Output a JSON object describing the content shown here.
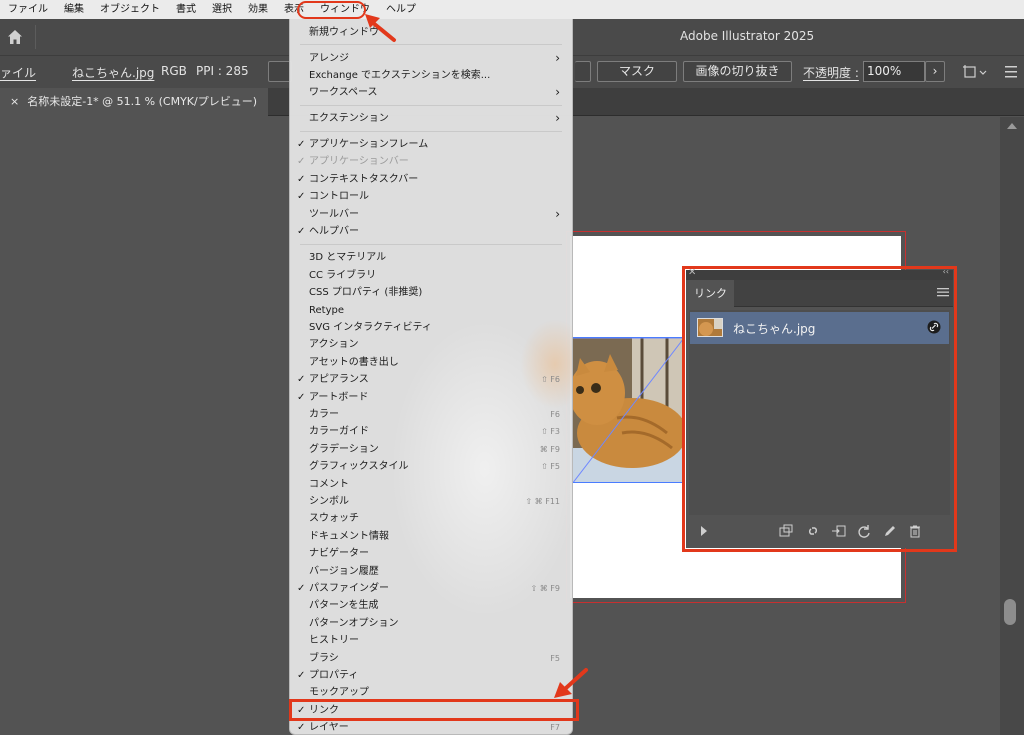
{
  "menubar": {
    "items": [
      "ファイル",
      "編集",
      "オブジェクト",
      "書式",
      "選択",
      "効果",
      "表示",
      "ウィンドウ",
      "ヘルプ"
    ],
    "active_index": 7
  },
  "app": {
    "title": "Adobe Illustrator 2025"
  },
  "control_bar": {
    "file_label_cut": "ァイル",
    "filename": "ねこちゃん.jpg",
    "color_mode": "RGB",
    "ppi": "PPI : 285",
    "mask_button": "マスク",
    "crop_button": "画像の切り抜き",
    "opacity_label": "不透明度 :",
    "opacity_value": "100%"
  },
  "document_tab": {
    "close": "×",
    "title": "名称未設定-1* @ 51.1 % (CMYK/プレビュー)"
  },
  "links_panel": {
    "tab_label": "リンク",
    "items": [
      {
        "name": "ねこちゃん.jpg"
      }
    ]
  },
  "window_menu": {
    "items": [
      {
        "label": "新規ウィンドウ",
        "checked": false
      },
      {
        "label": "アレンジ",
        "submenu": true
      },
      {
        "label": "Exchange でエクステンションを検索..."
      },
      {
        "label": "ワークスペース",
        "submenu": true
      },
      {
        "label": "エクステンション",
        "submenu": true
      },
      {
        "label": "アプリケーションフレーム",
        "checked": true
      },
      {
        "label": "アプリケーションバー",
        "checked": true,
        "disabled": true
      },
      {
        "label": "コンテキストタスクバー",
        "checked": true
      },
      {
        "label": "コントロール",
        "checked": true
      },
      {
        "label": "ツールバー",
        "submenu": true
      },
      {
        "label": "ヘルプバー",
        "checked": true
      },
      {
        "label": "3D とマテリアル"
      },
      {
        "label": "CC ライブラリ"
      },
      {
        "label": "CSS プロパティ (非推奨)"
      },
      {
        "label": "Retype"
      },
      {
        "label": "SVG インタラクティビティ"
      },
      {
        "label": "アクション"
      },
      {
        "label": "アセットの書き出し"
      },
      {
        "label": "アピアランス",
        "checked": true,
        "shortcut": "⇧ F6"
      },
      {
        "label": "アートボード",
        "checked": true
      },
      {
        "label": "カラー",
        "shortcut": "F6"
      },
      {
        "label": "カラーガイド",
        "shortcut": "⇧ F3"
      },
      {
        "label": "グラデーション",
        "shortcut": "⌘ F9"
      },
      {
        "label": "グラフィックスタイル",
        "shortcut": "⇧ F5"
      },
      {
        "label": "コメント"
      },
      {
        "label": "シンボル",
        "shortcut": "⇧ ⌘ F11"
      },
      {
        "label": "スウォッチ"
      },
      {
        "label": "ドキュメント情報"
      },
      {
        "label": "ナビゲーター"
      },
      {
        "label": "バージョン履歴"
      },
      {
        "label": "パスファインダー",
        "checked": true,
        "shortcut": "⇧ ⌘ F9"
      },
      {
        "label": "パターンを生成"
      },
      {
        "label": "パターンオプション"
      },
      {
        "label": "ヒストリー"
      },
      {
        "label": "ブラシ",
        "shortcut": "F5"
      },
      {
        "label": "プロパティ",
        "checked": true
      },
      {
        "label": "モックアップ"
      },
      {
        "label": "リンク",
        "checked": true
      },
      {
        "label": "レイヤー",
        "checked": true,
        "shortcut": "F7"
      }
    ]
  },
  "colors": {
    "highlight_red": "#e2381b",
    "menu_active_blue": "#2b67d6",
    "selected_row": "#5a6e8e"
  }
}
